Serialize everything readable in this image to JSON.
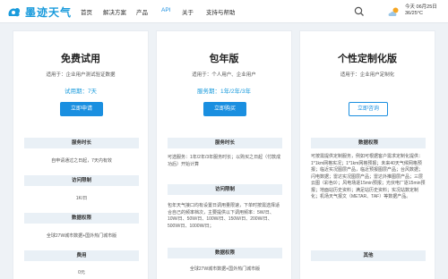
{
  "brand": {
    "name": "墨迹天气"
  },
  "nav": {
    "items": [
      {
        "label": "首页",
        "active": false
      },
      {
        "label": "解决方案",
        "active": false
      },
      {
        "label": "产品",
        "active": false
      },
      {
        "label": "API",
        "active": true
      },
      {
        "label": "关于",
        "active": false
      },
      {
        "label": "支持与帮助",
        "active": false
      }
    ]
  },
  "weather": {
    "date": "今天 06月25日",
    "temp": "36/25°C",
    "icon": "sun-cloud-icon"
  },
  "colors": {
    "accent": "#1a8fe0",
    "brand": "#1a9bdc",
    "section_bg": "#e9f0f6"
  },
  "plans": [
    {
      "title": "免费试用",
      "audience": "适用于：企业用户测试验证数据",
      "term": "试用期：7天",
      "button": "立即申请",
      "sections": [
        {
          "head": "服务时长",
          "text": "自申请通过之日起，7天内有效"
        },
        {
          "head": "访问限制",
          "text": "1K/日"
        },
        {
          "head": "数据权限",
          "text": "全球27W城市数据+国外热门城市版"
        },
        {
          "head": "费用",
          "text": "0元"
        }
      ]
    },
    {
      "title": "包年版",
      "audience": "适用于：个人用户、企业用户",
      "term": "服务期：1年/2年/3年",
      "button": "立即购买",
      "sections": [
        {
          "head": "服务时长",
          "text": "可选服务：1年/2年/3年服务时长；以购买之日起（付款成功后）开始计算"
        },
        {
          "head": "访问限制",
          "text": "包年天气接口均有设置日调用量限速，下单时按需选择适合自己的频率档次，主要提供以下调用频率：5W/日、10W/日、50W/日、100W/日、150W/日、200W/日、500W/日、1000W/日；"
        },
        {
          "head": "数据权限",
          "text": "全球27W城市数据+国外热门城市版"
        }
      ]
    },
    {
      "title": "个性定制化版",
      "audience": "适用于：企业用户定制化",
      "button": "立即咨询",
      "sections": [
        {
          "head": "数据权限",
          "text": "可按需提供定制服务，例如可根据客户需求定制化提供：1*1km网格实况；1*1km网格预报；未来40天气候网格预报；临近实况图层产品，临近预报图层产品；台风数据；闪电数据；雷达实况图层产品；雷达外推图层产品；三层云图（彩色9）；风电场逐15min预报；光伏电厂逐15min预报；地面站历史资料；满足站历史资料；实况站数定制化；机场天气报文（METAR、TAF）等数据产品。"
        },
        {
          "head": "其他",
          "text": ""
        }
      ]
    }
  ]
}
